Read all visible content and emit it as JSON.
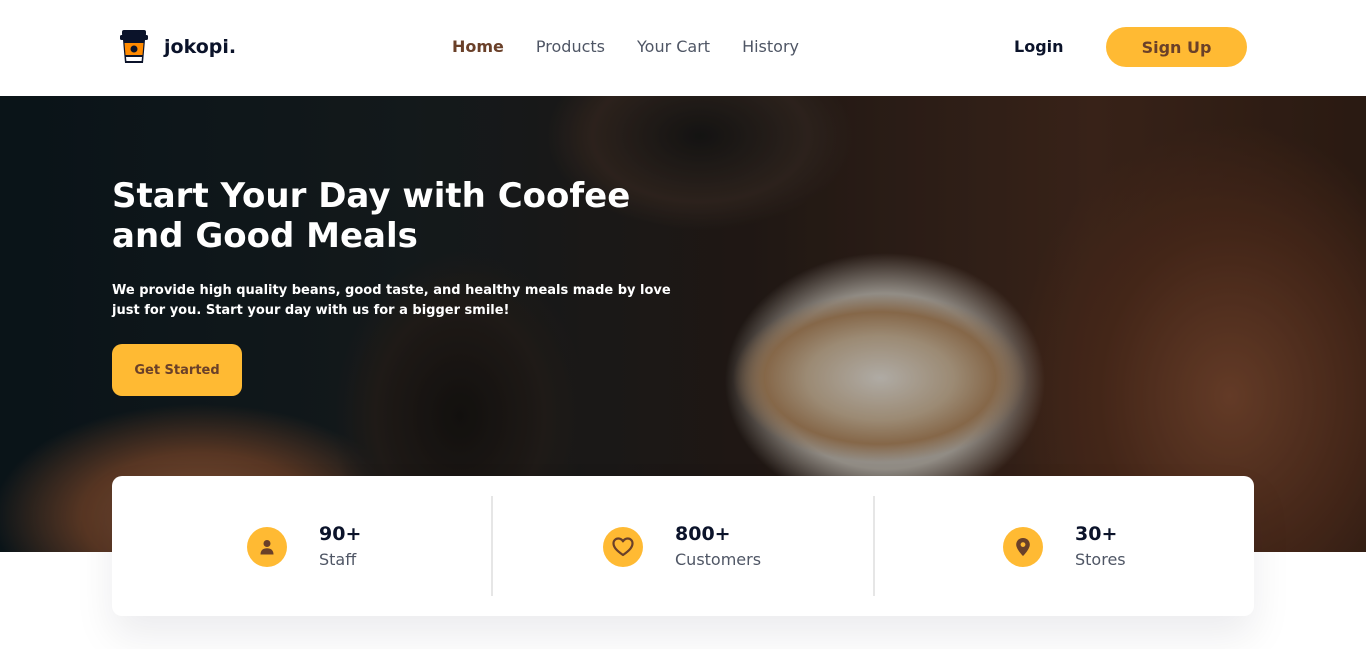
{
  "brand": {
    "name": "jokopi.",
    "logo_icon": "coffee-cup-icon"
  },
  "nav": {
    "items": [
      {
        "label": "Home",
        "active": true
      },
      {
        "label": "Products",
        "active": false
      },
      {
        "label": "Your Cart",
        "active": false
      },
      {
        "label": "History",
        "active": false
      }
    ]
  },
  "auth": {
    "login": "Login",
    "signup": "Sign Up"
  },
  "hero": {
    "title": "Start Your Day with Coofee and Good Meals",
    "description": "We provide high quality beans, good taste, and healthy meals made by love just for you. Start your day with us for a bigger smile!",
    "cta": "Get Started"
  },
  "stats": [
    {
      "value": "90+",
      "label": "Staff",
      "icon": "person-icon"
    },
    {
      "value": "800+",
      "label": "Customers",
      "icon": "heart-icon"
    },
    {
      "value": "30+",
      "label": "Stores",
      "icon": "location-pin-icon"
    }
  ],
  "colors": {
    "accent": "#ffba33",
    "brown": "#6a4029",
    "dark": "#0b132a",
    "muted": "#4f5665"
  }
}
